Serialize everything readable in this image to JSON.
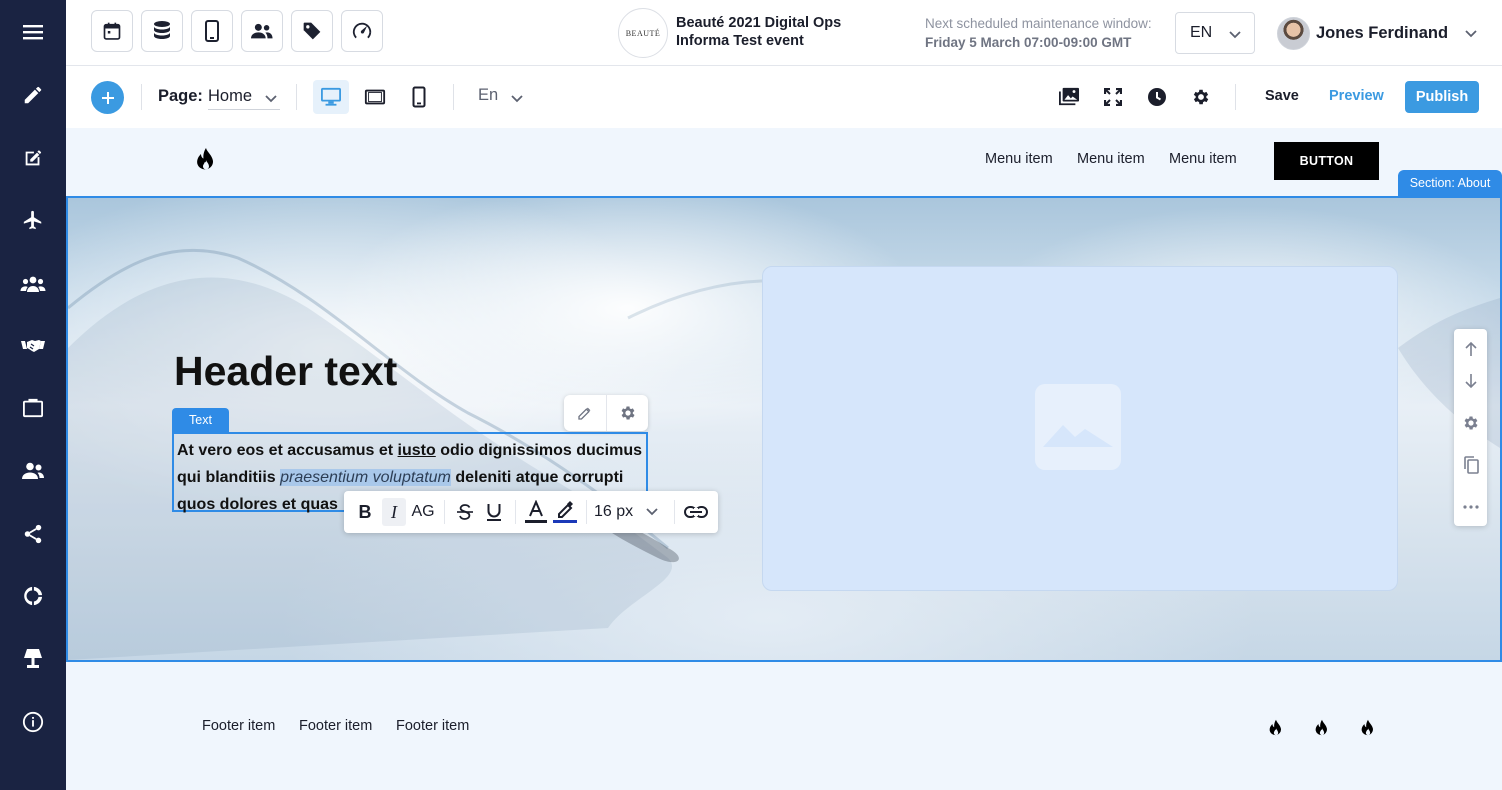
{
  "sidebar": {
    "items": [
      {
        "name": "menu-icon"
      },
      {
        "name": "pencil-icon"
      },
      {
        "name": "edit-square-icon"
      },
      {
        "name": "airplane-icon"
      },
      {
        "name": "group-icon"
      },
      {
        "name": "handshake-icon"
      },
      {
        "name": "briefcase-icon"
      },
      {
        "name": "users-icon"
      },
      {
        "name": "share-icon"
      },
      {
        "name": "chart-ring-icon"
      },
      {
        "name": "lamp-icon"
      },
      {
        "name": "info-icon"
      }
    ]
  },
  "topbar": {
    "tools": [
      "calendar-icon",
      "database-icon",
      "mobile-icon",
      "people-icon",
      "tag-icon",
      "speedometer-icon"
    ],
    "event_logo_text": "BEAUTÉ",
    "event_title_line1": "Beauté 2021 Digital Ops",
    "event_title_line2": "Informa Test event",
    "maintenance_label": "Next scheduled maintenance window:",
    "maintenance_time": "Friday 5 March 07:00-09:00 GMT",
    "language": "EN",
    "user_name": "Jones Ferdinand"
  },
  "toolbar": {
    "page_label": "Page:",
    "page_value": "Home",
    "locale": "En",
    "save": "Save",
    "preview": "Preview",
    "publish": "Publish"
  },
  "site": {
    "menu_items": [
      "Menu item",
      "Menu item",
      "Menu item"
    ],
    "button": "BUTTON",
    "section_tag": "Section: About",
    "hero_title": "Header text",
    "text_tag": "Text",
    "body_part1": "At vero eos et accusamus et ",
    "body_underlined": "iusto",
    "body_part2": " odio dignissimos ducimus qui blanditiis ",
    "body_italic": "praesentium voluptatum",
    "body_part3": " deleniti atque corrupti quos dolores et quas",
    "format": {
      "bold": "B",
      "italic": "I",
      "caps": "AG",
      "font_size": "16 px"
    },
    "footer_items": [
      "Footer item",
      "Footer item",
      "Footer item"
    ]
  },
  "colors": {
    "sidebar_bg": "#1a2342",
    "accent": "#3b9ae1",
    "selection": "#2f8be6",
    "canvas_bg": "#f0f6fd"
  }
}
